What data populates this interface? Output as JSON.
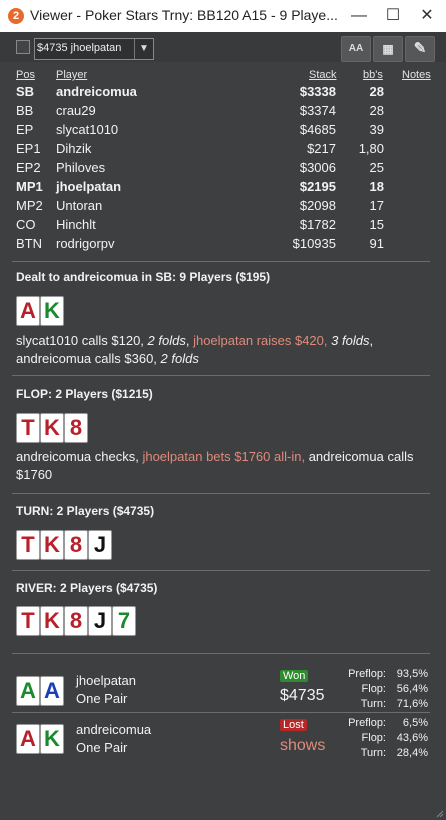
{
  "window": {
    "title": "Viewer - Poker Stars Trny: BB120 A15 - 9 Playe...",
    "app_icon": "2",
    "minimize": "—",
    "maximize": "☐",
    "close": "✕"
  },
  "toolbar": {
    "selector_value": "$4735 jhoelpatan",
    "font_button": "AA",
    "grid_button": "▦",
    "edit_button": "✎"
  },
  "table": {
    "headers": {
      "pos": "Pos",
      "player": "Player",
      "stack": "Stack",
      "bbs": "bb's",
      "notes": "Notes"
    },
    "rows": [
      {
        "pos": "SB",
        "player": "andreicomua",
        "stack": "$3338",
        "bbs": "28",
        "bold": true
      },
      {
        "pos": "BB",
        "player": "crau29",
        "stack": "$3374",
        "bbs": "28",
        "bold": false
      },
      {
        "pos": "EP",
        "player": "slycat1010",
        "stack": "$4685",
        "bbs": "39",
        "bold": false
      },
      {
        "pos": "EP1",
        "player": "Dihzik",
        "stack": "$217",
        "bbs": "1,80",
        "bold": false
      },
      {
        "pos": "EP2",
        "player": "Philoves",
        "stack": "$3006",
        "bbs": "25",
        "bold": false
      },
      {
        "pos": "MP1",
        "player": "jhoelpatan",
        "stack": "$2195",
        "bbs": "18",
        "bold": true
      },
      {
        "pos": "MP2",
        "player": "Untoran",
        "stack": "$2098",
        "bbs": "17",
        "bold": false
      },
      {
        "pos": "CO",
        "player": "Hinchlt",
        "stack": "$1782",
        "bbs": "15",
        "bold": false
      },
      {
        "pos": "BTN",
        "player": "rodrigorpv",
        "stack": "$10935",
        "bbs": "91",
        "bold": false
      }
    ]
  },
  "preflop": {
    "heading": "Dealt to andreicomua in SB: 9 Players ($195)",
    "cards": [
      {
        "rank": "A",
        "color": "red"
      },
      {
        "rank": "K",
        "color": "green"
      }
    ],
    "action_a": "slycat1010 calls $120, ",
    "action_b": "2 folds",
    "action_c": ", ",
    "action_d": "jhoelpatan raises $420,",
    "action_e": " ",
    "action_f": "3 folds",
    "action_g": ",",
    "action_h": "andreicomua calls $360, ",
    "action_i": "2 folds"
  },
  "flop": {
    "heading": "FLOP: 2 Players ($1215)",
    "cards": [
      {
        "rank": "T",
        "color": "red"
      },
      {
        "rank": "K",
        "color": "red"
      },
      {
        "rank": "8",
        "color": "red"
      }
    ],
    "action_a": "andreicomua checks, ",
    "action_b": "jhoelpatan bets $1760 all-in,",
    "action_c": " andreicomua calls",
    "action_d": "$1760"
  },
  "turn": {
    "heading": "TURN: 2 Players ($4735)",
    "cards": [
      {
        "rank": "T",
        "color": "red"
      },
      {
        "rank": "K",
        "color": "red"
      },
      {
        "rank": "8",
        "color": "red"
      },
      {
        "rank": "J",
        "color": "black"
      }
    ]
  },
  "river": {
    "heading": "RIVER: 2 Players ($4735)",
    "cards": [
      {
        "rank": "T",
        "color": "red"
      },
      {
        "rank": "K",
        "color": "red"
      },
      {
        "rank": "8",
        "color": "red"
      },
      {
        "rank": "J",
        "color": "black"
      },
      {
        "rank": "7",
        "color": "green"
      }
    ]
  },
  "results": [
    {
      "cards": [
        {
          "rank": "A",
          "color": "green"
        },
        {
          "rank": "A",
          "color": "blue"
        }
      ],
      "player": "jhoelpatan",
      "hand": "One Pair",
      "badge": "Won",
      "amount": "$4735",
      "stats": [
        {
          "label": "Preflop:",
          "value": "93,5%"
        },
        {
          "label": "Flop:",
          "value": "56,4%"
        },
        {
          "label": "Turn:",
          "value": "71,6%"
        }
      ]
    },
    {
      "cards": [
        {
          "rank": "A",
          "color": "red"
        },
        {
          "rank": "K",
          "color": "green"
        }
      ],
      "player": "andreicomua",
      "hand": "One Pair",
      "badge": "Lost",
      "amount": "shows",
      "stats": [
        {
          "label": "Preflop:",
          "value": "6,5%"
        },
        {
          "label": "Flop:",
          "value": "43,6%"
        },
        {
          "label": "Turn:",
          "value": "28,4%"
        }
      ]
    }
  ],
  "colors": {
    "background": "#3d3f41",
    "highlight": "#e08a7a",
    "won": "#2e8b2e",
    "lost": "#b62727"
  }
}
